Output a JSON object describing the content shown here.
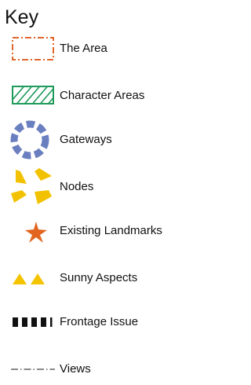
{
  "key": {
    "title": "Key",
    "items": [
      {
        "id": "area",
        "label": "The Area",
        "color": "#e0662a"
      },
      {
        "id": "character-areas",
        "label": "Character Areas",
        "color": "#1e9a5a"
      },
      {
        "id": "gateways",
        "label": "Gateways",
        "color": "#6a7fc0"
      },
      {
        "id": "nodes",
        "label": "Nodes",
        "color": "#f2c200"
      },
      {
        "id": "existing-landmarks",
        "label": "Existing Landmarks",
        "color": "#e2651f"
      },
      {
        "id": "sunny-aspects",
        "label": "Sunny Aspects",
        "color": "#f5c400"
      },
      {
        "id": "frontage-issue",
        "label": "Frontage Issue",
        "color": "#111111"
      },
      {
        "id": "views",
        "label": "Views",
        "color": "#444444"
      }
    ]
  }
}
